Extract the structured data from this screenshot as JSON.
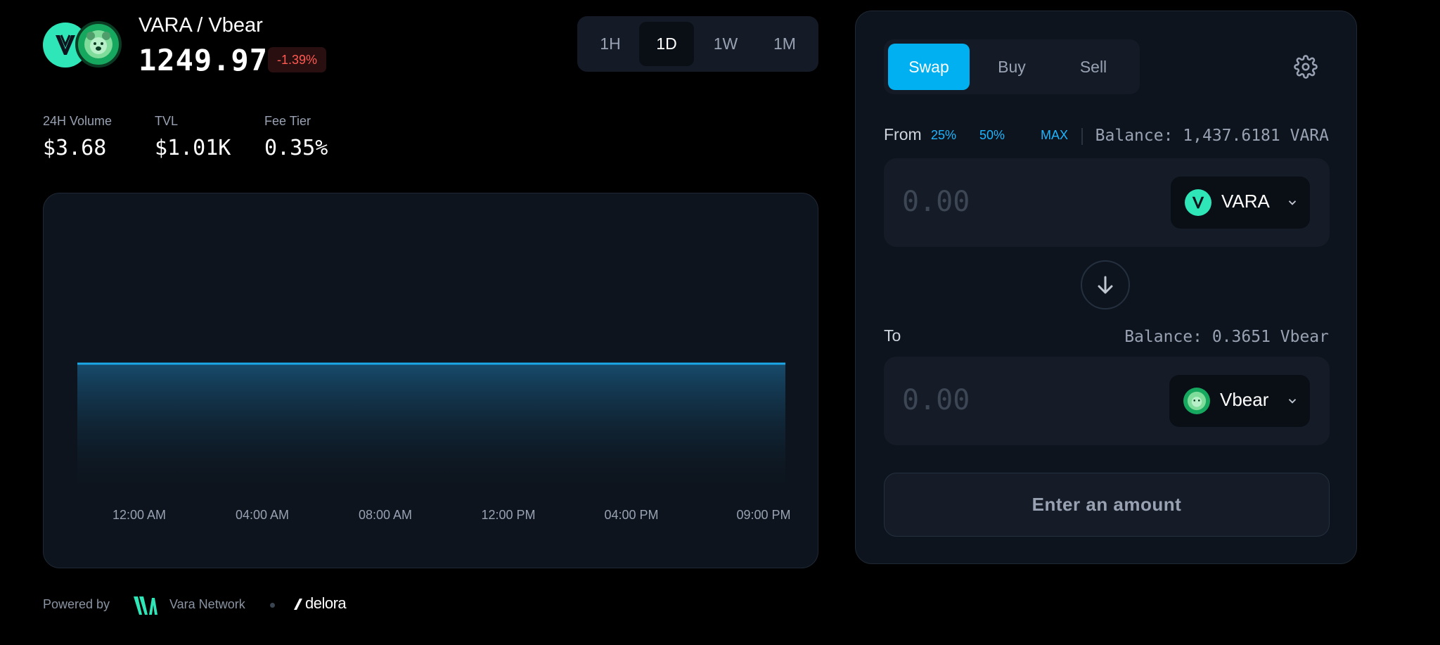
{
  "header": {
    "pair_name": "VARA / Vbear",
    "price": "1249.97",
    "change": "-1.39%",
    "timeframes": [
      "1H",
      "1D",
      "1W",
      "1M"
    ],
    "active_timeframe": "1D"
  },
  "stats": [
    {
      "label": "24H Volume",
      "value": "$3.68"
    },
    {
      "label": "TVL",
      "value": "$1.01K"
    },
    {
      "label": "Fee Tier",
      "value": "0.35%"
    }
  ],
  "chart_data": {
    "type": "area",
    "x": [
      "12:00 AM",
      "04:00 AM",
      "08:00 AM",
      "12:00 PM",
      "04:00 PM",
      "09:00 PM"
    ],
    "series": [
      {
        "values": [
          1,
          1,
          1,
          1,
          1,
          1
        ]
      }
    ],
    "grid": false,
    "color": "#1aa8e8"
  },
  "footer": {
    "powered_by": "Powered by",
    "network": "Vara Network",
    "partner": "delora"
  },
  "swap": {
    "modes": [
      "Swap",
      "Buy",
      "Sell"
    ],
    "active_mode": "Swap",
    "from_label": "From",
    "pct_options": [
      "25%",
      "50%",
      "MAX"
    ],
    "from_balance": "Balance: 1,437.6181 VARA",
    "from_placeholder": "0.00",
    "from_token": "VARA",
    "to_label": "To",
    "to_balance": "Balance: 0.3651 Vbear",
    "to_placeholder": "0.00",
    "to_token": "Vbear",
    "action_label": "Enter an amount"
  },
  "colors": {
    "accent": "#00b0f0",
    "negative": "#ff5a52",
    "vara": "#2ee6b8",
    "vbear": "#17a85f"
  }
}
